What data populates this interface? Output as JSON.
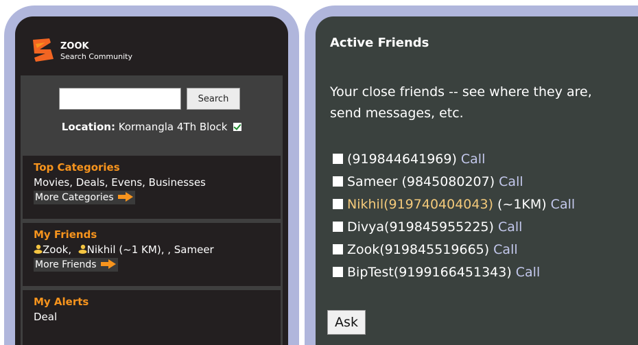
{
  "left": {
    "brand": {
      "name": "ZOOK",
      "tagline": "Search Community"
    },
    "search": {
      "value": "",
      "placeholder": "",
      "button_label": "Search"
    },
    "location": {
      "label": "Location:",
      "value": "Kormangla 4Th Block",
      "checked": true
    },
    "categories": {
      "title": "Top Categories",
      "items": "Movies, Deals, Evens, Businesses",
      "more_label": "More Categories"
    },
    "friends": {
      "title": "My Friends",
      "names": [
        "Zook,",
        "Nikhil (~1 KM), , Sameer"
      ],
      "more_label": "More Friends"
    },
    "alerts": {
      "title": "My Alerts",
      "items": "Deal"
    }
  },
  "right": {
    "title": "Active Friends",
    "intro": "Your close friends -- see where they are, send messages, etc.",
    "friends": [
      {
        "name": "(919844641969)",
        "extra": "",
        "call": "Call",
        "highlighted": false
      },
      {
        "name": "Sameer (9845080207)",
        "extra": "",
        "call": "Call",
        "highlighted": false
      },
      {
        "name": "Nikhil(919740404043)",
        "extra": "(~1KM)",
        "call": "Call",
        "highlighted": true
      },
      {
        "name": "Divya(919845955225)",
        "extra": "",
        "call": "Call",
        "highlighted": false
      },
      {
        "name": "Zook(919845519665)",
        "extra": "",
        "call": "Call",
        "highlighted": false
      },
      {
        "name": "BipTest(9199166451343)",
        "extra": "",
        "call": "Call",
        "highlighted": false
      }
    ],
    "ask_label": "Ask"
  },
  "colors": {
    "frame": "#b0b6dc",
    "left_screen": "#231f20",
    "right_screen": "#3a413e",
    "accent_orange": "#f7941d",
    "call_link": "#c3c8ec",
    "highlight_name": "#f3c97a"
  },
  "icons": [
    "zook-logo-icon",
    "checkbox-checked-icon",
    "arrow-right-icon",
    "friend-icon"
  ]
}
